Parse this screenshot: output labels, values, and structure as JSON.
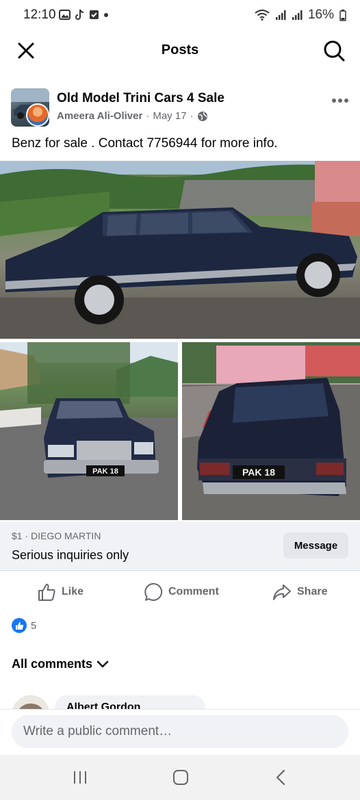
{
  "status_bar": {
    "time": "12:10",
    "battery": "16%"
  },
  "header": {
    "title": "Posts"
  },
  "post": {
    "group_name": "Old Model Trini Cars 4 Sale",
    "author": "Ameera Ali-Oliver",
    "separator": "·",
    "date": "May 17",
    "text": "Benz for sale . Contact 7756944 for more info.",
    "plate_1": "PAK 18",
    "plate_2": "PAK 18"
  },
  "listing": {
    "price_location": "$1 · DIEGO MARTIN",
    "title": "Serious inquiries only",
    "message_button": "Message"
  },
  "actions": {
    "like": "Like",
    "comment": "Comment",
    "share": "Share"
  },
  "reactions": {
    "count": "5"
  },
  "comments": {
    "filter_label": "All comments",
    "first_commenter": "Albert Gordon"
  },
  "composer": {
    "placeholder": "Write a public comment…"
  },
  "colors": {
    "brand_blue": "#1877f2",
    "secondary_text": "#65676b"
  },
  "icons": [
    "close-icon",
    "search-icon",
    "globe-icon",
    "more-icon",
    "like-icon",
    "comment-icon",
    "share-icon",
    "chevron-down-icon",
    "recents-icon",
    "home-icon",
    "back-icon"
  ]
}
